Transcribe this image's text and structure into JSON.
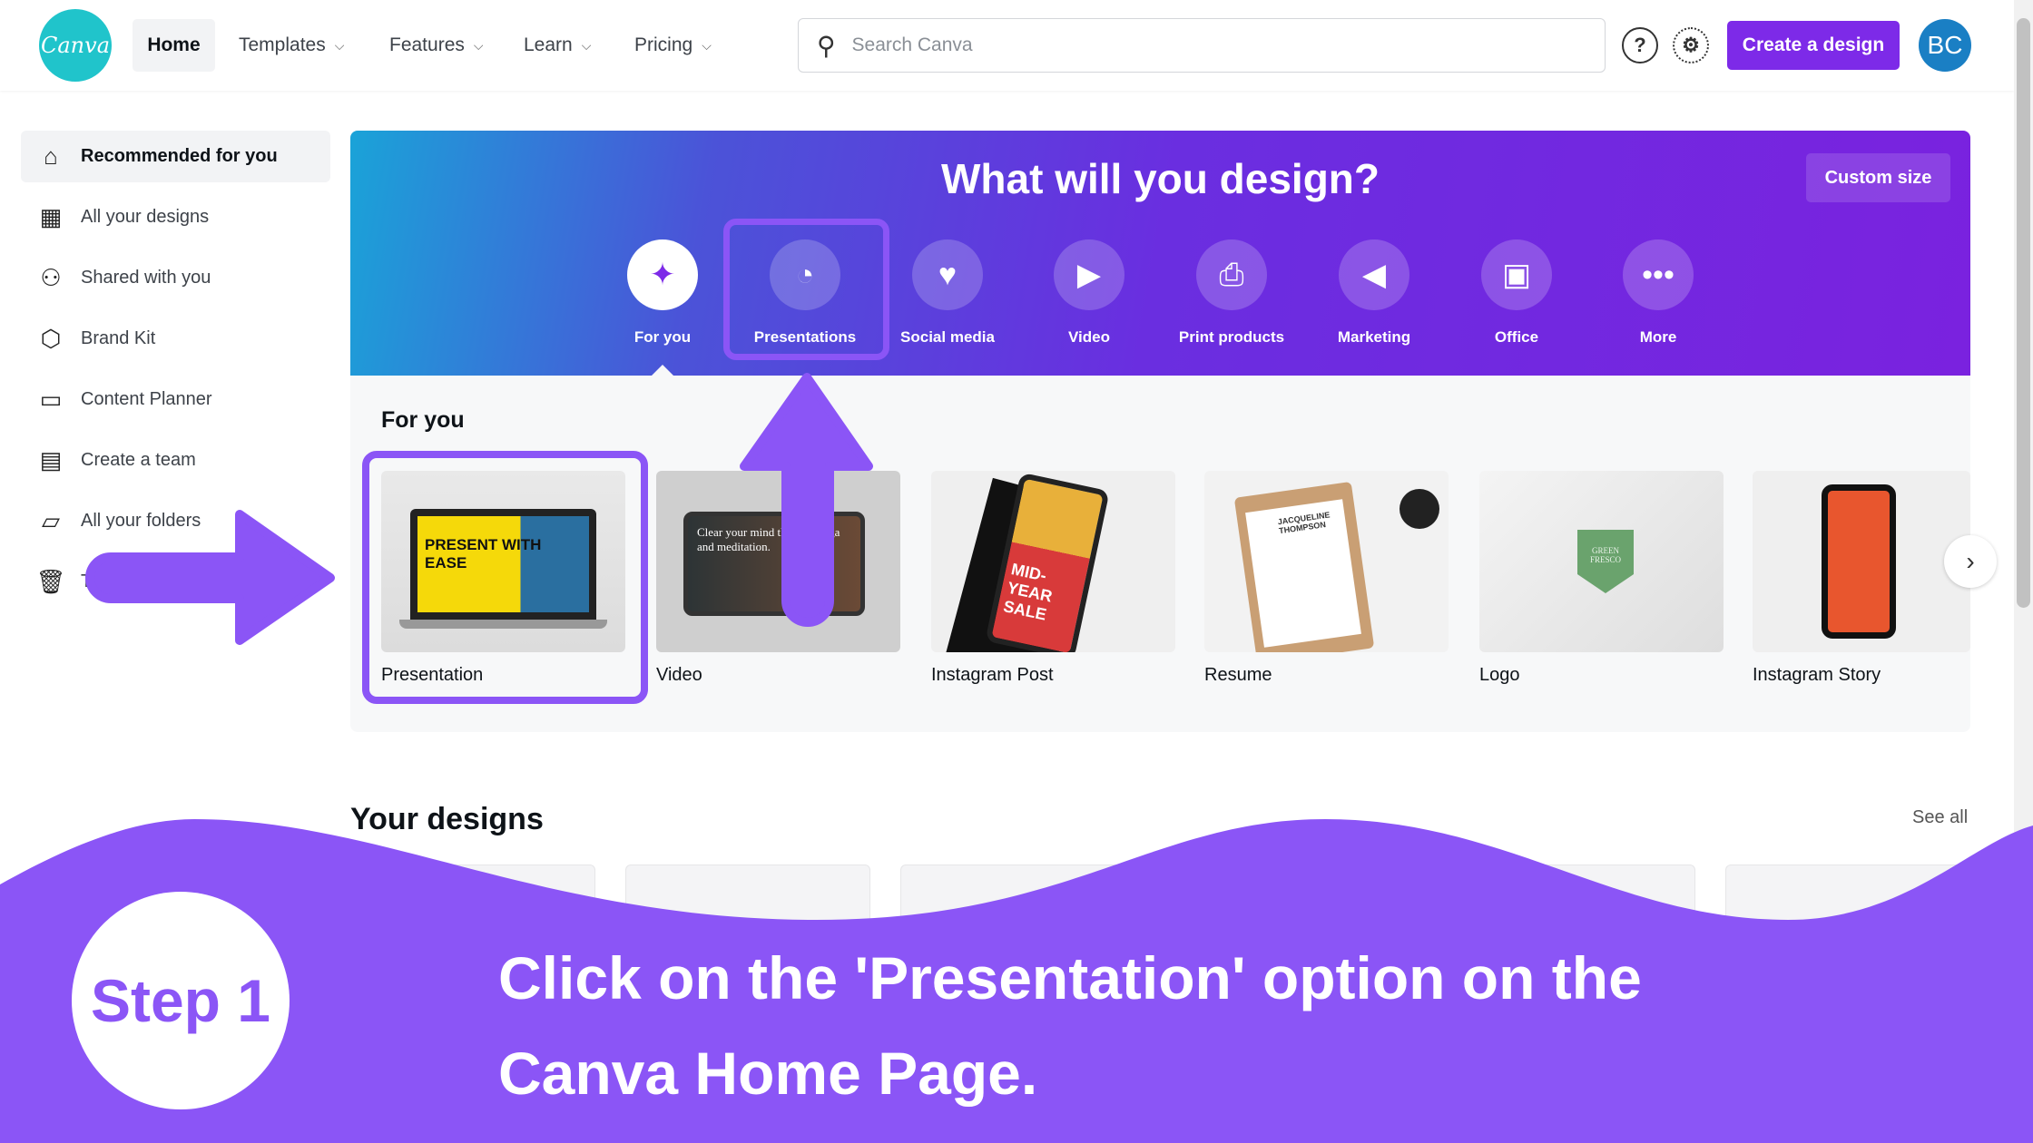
{
  "header": {
    "logo_text": "Canva",
    "nav": [
      {
        "label": "Home"
      },
      {
        "label": "Templates"
      },
      {
        "label": "Features"
      },
      {
        "label": "Learn"
      },
      {
        "label": "Pricing"
      }
    ],
    "search_placeholder": "Search Canva",
    "create_label": "Create a design",
    "avatar_initials": "BC"
  },
  "sidebar": {
    "items": [
      {
        "label": "Recommended for you",
        "icon": "home-icon"
      },
      {
        "label": "All your designs",
        "icon": "grid-icon"
      },
      {
        "label": "Shared with you",
        "icon": "people-icon"
      },
      {
        "label": "Brand Kit",
        "icon": "brand-kit-icon"
      },
      {
        "label": "Content Planner",
        "icon": "calendar-icon"
      },
      {
        "label": "Create a team",
        "icon": "building-icon"
      },
      {
        "label": "All your folders",
        "icon": "folder-icon"
      },
      {
        "label": "T",
        "icon": "trash-icon"
      }
    ]
  },
  "banner": {
    "title": "What will you design?",
    "custom_size": "Custom size",
    "categories": [
      {
        "label": "For you",
        "glyph": "✦"
      },
      {
        "label": "Presentations",
        "glyph": "◔"
      },
      {
        "label": "Social media",
        "glyph": "♥"
      },
      {
        "label": "Video",
        "glyph": "▶"
      },
      {
        "label": "Print products",
        "glyph": "⎙"
      },
      {
        "label": "Marketing",
        "glyph": "◀"
      },
      {
        "label": "Office",
        "glyph": "▣"
      },
      {
        "label": "More",
        "glyph": "•••"
      }
    ]
  },
  "for_you": {
    "heading": "For you",
    "cards": [
      {
        "label": "Presentation",
        "thumb_text": "PRESENT WITH EASE"
      },
      {
        "label": "Video",
        "thumb_text": "Clear your mind through yoga and meditation."
      },
      {
        "label": "Instagram Post",
        "thumb_text": "MID-YEAR SALE"
      },
      {
        "label": "Resume",
        "thumb_text": "JACQUELINE THOMPSON"
      },
      {
        "label": "Logo",
        "thumb_text": "GREEN FRESCO"
      },
      {
        "label": "Instagram Story"
      }
    ]
  },
  "your_designs": {
    "heading": "Your designs",
    "see_all": "See all"
  },
  "overlay": {
    "step": "Step 1",
    "caption_line1": "Click on the 'Presentation' option on the",
    "caption_line2": "Canva Home Page.",
    "accent": "#8b55f6"
  }
}
